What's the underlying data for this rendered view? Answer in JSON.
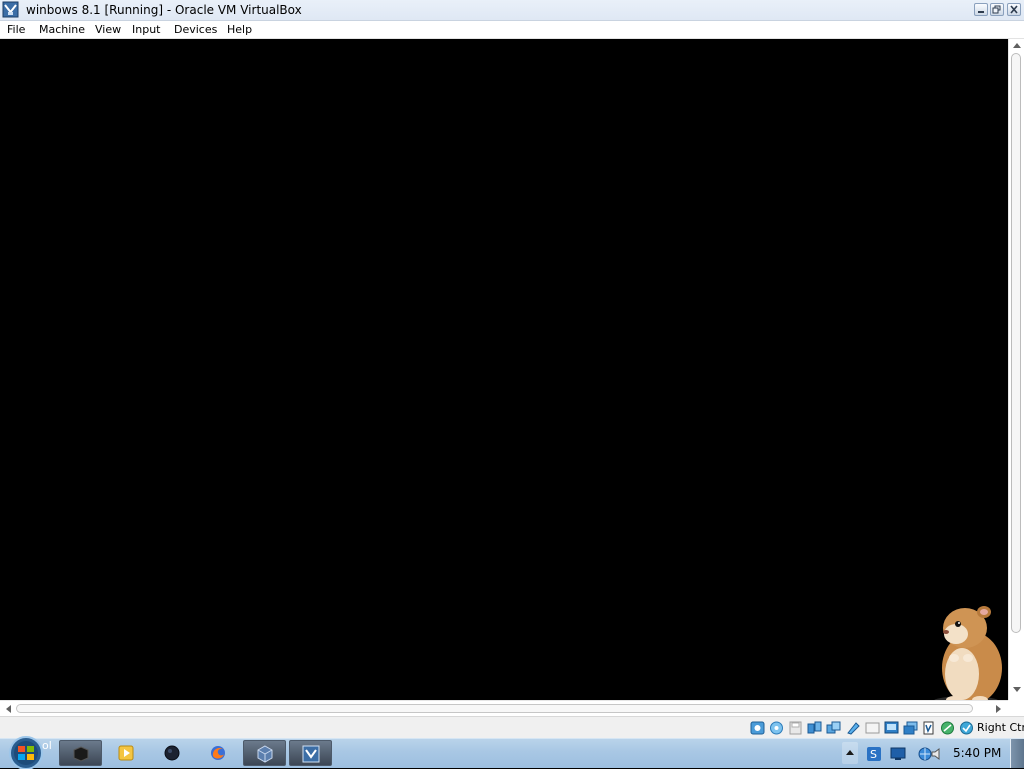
{
  "window": {
    "title": "winbows 8.1 [Running] - Oracle VM VirtualBox",
    "controls": [
      "minimize",
      "restore",
      "close"
    ]
  },
  "menubar": {
    "items": [
      {
        "label": "File"
      },
      {
        "label": "Machine"
      },
      {
        "label": "View"
      },
      {
        "label": "Input"
      },
      {
        "label": "Devices"
      },
      {
        "label": "Help"
      }
    ]
  },
  "vm_screen": {
    "state": "black display"
  },
  "statusbar": {
    "indicators": [
      "hard-disk-icon",
      "optical-drive-icon",
      "floppy-icon",
      "network-icon",
      "usb-icon",
      "shared-folders-icon",
      "display-icon",
      "video-capture-icon",
      "recording-icon",
      "cpu-icon",
      "mouse-integration-icon",
      "keyboard-capture-icon"
    ],
    "host_key": "Right Ctrl"
  },
  "taskbar": {
    "start_label": "ol",
    "apps": [
      {
        "name": "terminal-app-icon",
        "active": true
      },
      {
        "name": "media-player-app-icon",
        "active": false
      },
      {
        "name": "sphere-app-icon",
        "active": false
      },
      {
        "name": "firefox-app-icon",
        "active": false
      },
      {
        "name": "virtualbox-manager-app-icon",
        "active": true
      },
      {
        "name": "virtualbox-vm-app-icon",
        "active": true
      }
    ],
    "clock": "5:40 PM"
  },
  "colors": {
    "titlebar": "#dfe8f4",
    "vm_background": "#000000",
    "taskbar": "#a8c7e4"
  }
}
